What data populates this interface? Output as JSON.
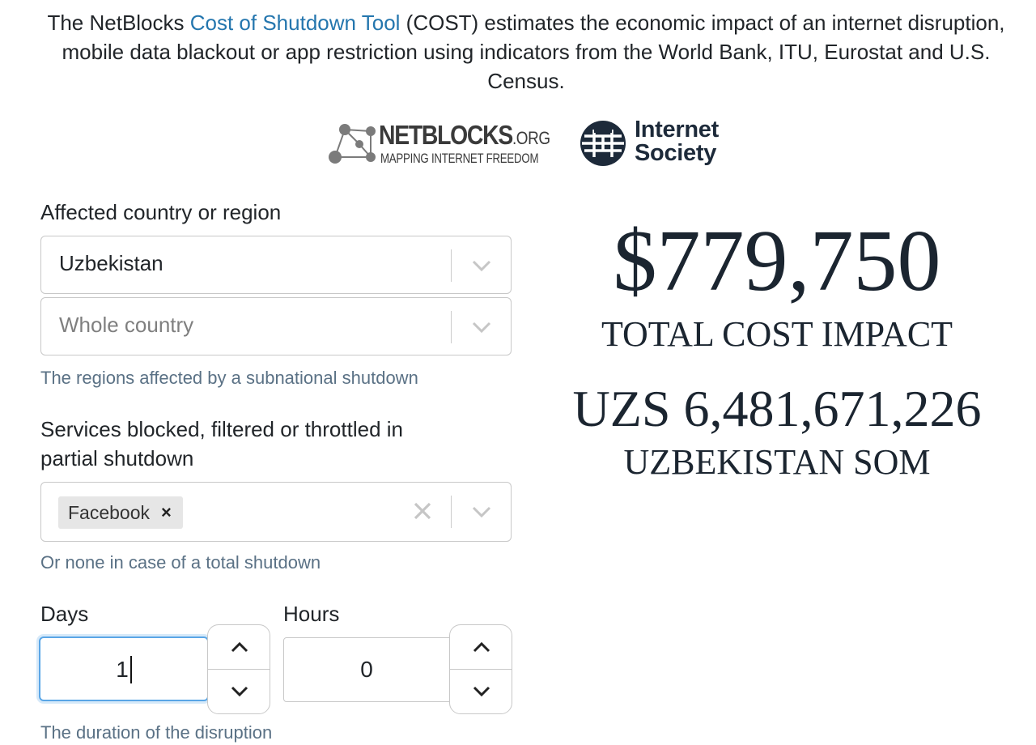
{
  "intro": {
    "before": "The NetBlocks ",
    "link": "Cost of Shutdown Tool",
    "after": " (COST) estimates the economic impact of an internet disruption, mobile data blackout or app restriction using indicators from the World Bank, ITU, Eurostat and U.S. Census."
  },
  "logos": {
    "netblocks_name": "NETBLOCKS",
    "netblocks_suffix": ".ORG",
    "netblocks_tagline": "MAPPING INTERNET FREEDOM",
    "isoc_line1": "Internet",
    "isoc_line2": "Society"
  },
  "form": {
    "country_label": "Affected country or region",
    "country_value": "Uzbekistan",
    "region_placeholder": "Whole country",
    "region_help": "The regions affected by a subnational shutdown",
    "services_label_line1": "Services blocked, filtered or throttled in",
    "services_label_line2": "partial shutdown",
    "services_tags": [
      "Facebook"
    ],
    "tag_remove": "×",
    "services_help": "Or none in case of a total shutdown",
    "days_label": "Days",
    "days_value": "1",
    "hours_label": "Hours",
    "hours_value": "0",
    "duration_help": "The duration of the disruption"
  },
  "result": {
    "total": "$779,750",
    "total_label": "TOTAL COST IMPACT",
    "local": "UZS 6,481,671,226",
    "local_label": "UZBEKISTAN SOM"
  },
  "colors": {
    "link": "#2476ae",
    "help_text": "#5a7185",
    "focus_border": "#5aa6e6",
    "result_text": "#1b2530"
  },
  "icons": {
    "dropdown": "chevron-down-icon",
    "clear": "clear-x-icon",
    "spin_up": "chevron-up-icon",
    "spin_down": "chevron-down-icon"
  }
}
